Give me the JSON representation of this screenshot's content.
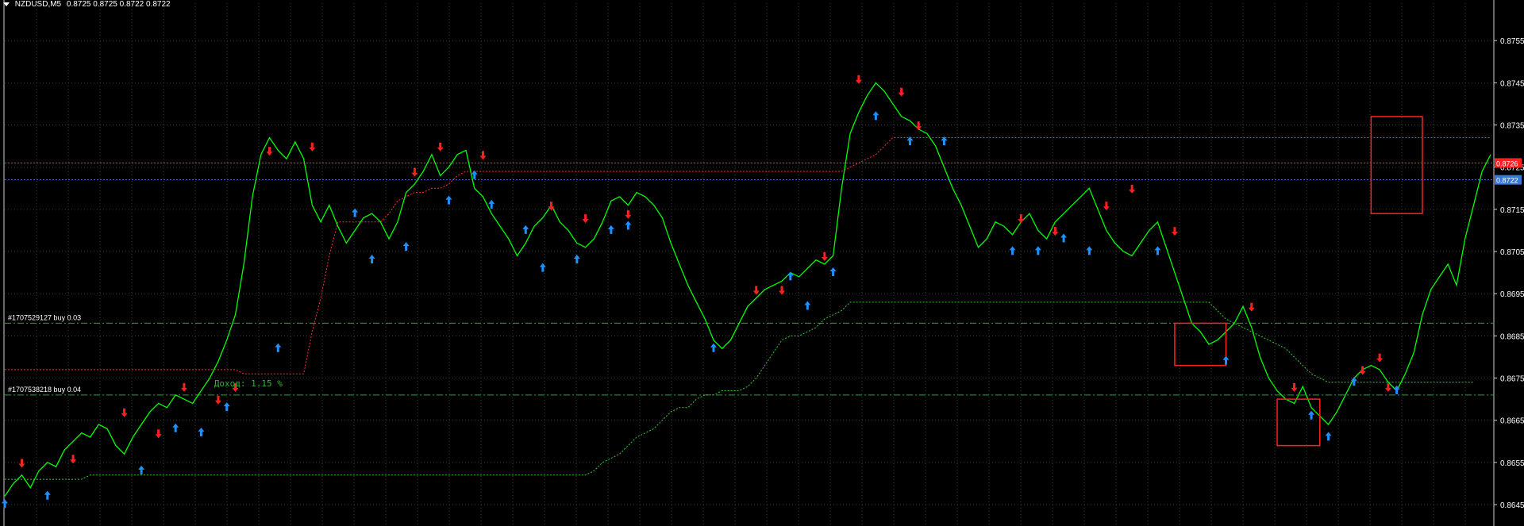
{
  "header": {
    "symbol": "NZDUSD,M5",
    "ohlc": "0.8725 0.8725 0.8722 0.8722"
  },
  "colors": {
    "background": "#000000",
    "price_line": "#00ff00",
    "grid": "#2f3f2f",
    "buy_arrow": "#1e90ff",
    "sell_arrow": "#ff2020",
    "stop_line": "#ff3030",
    "trail_line": "#33cc33",
    "bid_line": "#4169e1",
    "box": "#ff2020",
    "order_line": "#22aa22",
    "axis_text": "#ffffff"
  },
  "chart_data": {
    "type": "line",
    "title": "NZDUSD,M5",
    "ylim": [
      0.8642,
      0.8762
    ],
    "y_ticks": [
      "0.8755",
      "0.8745",
      "0.8735",
      "0.8725",
      "0.8715",
      "0.8705",
      "0.8695",
      "0.8685",
      "0.8675",
      "0.8665",
      "0.8655",
      "0.8645"
    ],
    "price_labels": [
      {
        "text": "0.8726",
        "value": 0.8726,
        "color": "#ff2020"
      },
      {
        "text": "0.8722",
        "value": 0.8722,
        "color": "#3a78d6"
      }
    ],
    "series": [
      {
        "values": [
          0.8647,
          0.865,
          0.8652,
          0.8649,
          0.8653,
          0.8655,
          0.8654,
          0.8658,
          0.866,
          0.8662,
          0.8661,
          0.8664,
          0.8663,
          0.8659,
          0.8657,
          0.8661,
          0.8664,
          0.8667,
          0.8669,
          0.8668,
          0.8671,
          0.867,
          0.8669,
          0.8672,
          0.8675,
          0.8679,
          0.8684,
          0.869,
          0.8702,
          0.8718,
          0.8728,
          0.8732,
          0.8729,
          0.8727,
          0.8731,
          0.8727,
          0.8716,
          0.8712,
          0.8716,
          0.8711,
          0.8707,
          0.871,
          0.8713,
          0.8714,
          0.8712,
          0.8708,
          0.8712,
          0.8719,
          0.8721,
          0.8724,
          0.8728,
          0.8723,
          0.8725,
          0.8728,
          0.8729,
          0.872,
          0.8718,
          0.8714,
          0.8711,
          0.8708,
          0.8704,
          0.8707,
          0.8711,
          0.8713,
          0.8716,
          0.8712,
          0.871,
          0.8707,
          0.8706,
          0.8708,
          0.8712,
          0.8717,
          0.8718,
          0.8716,
          0.8719,
          0.8718,
          0.8716,
          0.8713,
          0.8707,
          0.8702,
          0.8697,
          0.8693,
          0.8689,
          0.8684,
          0.8682,
          0.8684,
          0.8688,
          0.8692,
          0.8694,
          0.8696,
          0.8697,
          0.8698,
          0.87,
          0.8699,
          0.8701,
          0.8703,
          0.8702,
          0.8704,
          0.872,
          0.8733,
          0.8738,
          0.8742,
          0.8745,
          0.8743,
          0.874,
          0.8737,
          0.8736,
          0.8734,
          0.8733,
          0.873,
          0.8725,
          0.872,
          0.8716,
          0.8711,
          0.8706,
          0.8708,
          0.8712,
          0.8711,
          0.8709,
          0.8712,
          0.8714,
          0.871,
          0.8708,
          0.8712,
          0.8714,
          0.8716,
          0.8718,
          0.872,
          0.8715,
          0.871,
          0.8707,
          0.8705,
          0.8704,
          0.8707,
          0.871,
          0.8712,
          0.8706,
          0.87,
          0.8694,
          0.8688,
          0.8686,
          0.8683,
          0.8684,
          0.8686,
          0.8688,
          0.8692,
          0.8687,
          0.868,
          0.8675,
          0.8672,
          0.867,
          0.8669,
          0.8673,
          0.8668,
          0.8666,
          0.8664,
          0.8667,
          0.8671,
          0.8675,
          0.8677,
          0.8678,
          0.8677,
          0.8674,
          0.8672,
          0.8676,
          0.8681,
          0.869,
          0.8696,
          0.8699,
          0.8702,
          0.8697,
          0.8708,
          0.8716,
          0.8724,
          0.8728
        ]
      }
    ],
    "stop_line_values": [
      0.8677,
      0.8677,
      0.8677,
      0.8677,
      0.8677,
      0.8677,
      0.8677,
      0.8677,
      0.8677,
      0.8677,
      0.8677,
      0.8677,
      0.8677,
      0.8677,
      0.8677,
      0.8677,
      0.8677,
      0.8677,
      0.8677,
      0.8677,
      0.8677,
      0.8677,
      0.8677,
      0.8677,
      0.8677,
      0.8677,
      0.8677,
      0.8677,
      0.8676,
      0.8676,
      0.8676,
      0.8676,
      0.8676,
      0.8676,
      0.8676,
      0.8676,
      0.8686,
      0.8694,
      0.8704,
      0.8712,
      0.8712,
      0.8712,
      0.8712,
      0.8712,
      0.8712,
      0.8714,
      0.8717,
      0.8718,
      0.8719,
      0.8719,
      0.872,
      0.872,
      0.8721,
      0.8723,
      0.8724,
      0.8724,
      0.8724,
      0.8724,
      0.8724,
      0.8724,
      0.8724,
      0.8724,
      0.8724,
      0.8724,
      0.8724,
      0.8724,
      0.8724,
      0.8724,
      0.8724,
      0.8724,
      0.8724,
      0.8724,
      0.8724,
      0.8724,
      0.8724,
      0.8724,
      0.8724,
      0.8724,
      0.8724,
      0.8724,
      0.8724,
      0.8724,
      0.8724,
      0.8724,
      0.8724,
      0.8724,
      0.8724,
      0.8724,
      0.8724,
      0.8724,
      0.8724,
      0.8724,
      0.8724,
      0.8724,
      0.8724,
      0.8724,
      0.8724,
      0.8724,
      0.8724,
      0.8725,
      0.8726,
      0.8727,
      0.8728,
      0.873,
      0.8732,
      0.8732,
      0.8732,
      0.8732,
      0.8732,
      0.8732,
      0.8732,
      0.8732,
      0.8732,
      0.8732,
      0.8732,
      0.8732,
      0.8732,
      0.8732,
      0.8732,
      0.8732,
      0.8732,
      0.8732,
      0.8732,
      0.8732,
      0.8732,
      0.8732,
      0.8732,
      0.8732,
      0.8732,
      0.8732,
      0.8732,
      0.8732,
      0.8732,
      0.8732,
      0.8732,
      0.8732,
      0.8732,
      0.8732,
      0.8732,
      0.8732,
      0.8732,
      0.8732,
      0.8732,
      0.8732,
      0.8732,
      0.8732,
      0.8732,
      0.8732,
      0.8732,
      0.8732,
      0.8732,
      0.8732,
      0.8732,
      0.8732,
      0.8732,
      0.8732,
      0.8732,
      0.8732,
      0.8732,
      0.8732,
      0.8732,
      0.8732,
      0.8732,
      0.8732,
      0.8732,
      0.8732,
      0.8732,
      0.8732,
      0.8732,
      0.8732,
      0.8732,
      0.8732,
      0.8732,
      0.8732,
      0.8732
    ],
    "trail_line_values": [
      0.8651,
      0.8651,
      0.8651,
      0.8651,
      0.8651,
      0.8651,
      0.8651,
      0.8651,
      0.8651,
      0.8651,
      0.8652,
      0.8652,
      0.8652,
      0.8652,
      0.8652,
      0.8652,
      0.8652,
      0.8652,
      0.8652,
      0.8652,
      0.8652,
      0.8652,
      0.8652,
      0.8652,
      0.8652,
      0.8652,
      0.8652,
      0.8652,
      0.8652,
      0.8652,
      0.8652,
      0.8652,
      0.8652,
      0.8652,
      0.8652,
      0.8652,
      0.8652,
      0.8652,
      0.8652,
      0.8652,
      0.8652,
      0.8652,
      0.8652,
      0.8652,
      0.8652,
      0.8652,
      0.8652,
      0.8652,
      0.8652,
      0.8652,
      0.8652,
      0.8652,
      0.8652,
      0.8652,
      0.8652,
      0.8652,
      0.8652,
      0.8652,
      0.8652,
      0.8652,
      0.8652,
      0.8652,
      0.8652,
      0.8652,
      0.8652,
      0.8652,
      0.8652,
      0.8652,
      0.8652,
      0.8653,
      0.8655,
      0.8656,
      0.8657,
      0.8659,
      0.8661,
      0.8662,
      0.8663,
      0.8665,
      0.8667,
      0.8668,
      0.8668,
      0.867,
      0.8671,
      0.8671,
      0.8672,
      0.8672,
      0.8672,
      0.8673,
      0.8675,
      0.8678,
      0.8681,
      0.8684,
      0.8685,
      0.8685,
      0.8686,
      0.8687,
      0.8689,
      0.869,
      0.8691,
      0.8693,
      0.8693,
      0.8693,
      0.8693,
      0.8693,
      0.8693,
      0.8693,
      0.8693,
      0.8693,
      0.8693,
      0.8693,
      0.8693,
      0.8693,
      0.8693,
      0.8693,
      0.8693,
      0.8693,
      0.8693,
      0.8693,
      0.8693,
      0.8693,
      0.8693,
      0.8693,
      0.8693,
      0.8693,
      0.8693,
      0.8693,
      0.8693,
      0.8693,
      0.8693,
      0.8693,
      0.8693,
      0.8693,
      0.8693,
      0.8693,
      0.8693,
      0.8693,
      0.8693,
      0.8693,
      0.8693,
      0.8693,
      0.8693,
      0.8693,
      0.8691,
      0.8689,
      0.8688,
      0.8687,
      0.8686,
      0.8685,
      0.8684,
      0.8683,
      0.8682,
      0.868,
      0.8678,
      0.8676,
      0.8675,
      0.8674,
      0.8674,
      0.8674,
      0.8674,
      0.8674,
      0.8674,
      0.8674,
      0.8674,
      0.8674,
      0.8674,
      0.8674,
      0.8674,
      0.8674,
      0.8674,
      0.8674,
      0.8674,
      0.8674,
      0.8674
    ],
    "horizontal_lines": [
      {
        "value": 0.8726,
        "color": "#ff3030",
        "style": "dotted"
      },
      {
        "value": 0.8722,
        "color": "#4169e1",
        "style": "dotted"
      },
      {
        "value": 0.8688,
        "color": "#22aa22",
        "style": "dashdot",
        "label": "#1707529127 buy 0.03"
      },
      {
        "value": 0.8671,
        "color": "#22aa22",
        "style": "dashdot",
        "label": "#1707538218 buy 0.04"
      }
    ],
    "annotations": [
      {
        "text": "Доход: 1.15 %",
        "index": 26,
        "value": 0.8674,
        "color": "#2fb82f"
      }
    ],
    "buy_arrows": [
      [
        0,
        0.8647
      ],
      [
        5,
        0.8649
      ],
      [
        16,
        0.8655
      ],
      [
        20,
        0.8665
      ],
      [
        23,
        0.8664
      ],
      [
        26,
        0.867
      ],
      [
        32,
        0.8684
      ],
      [
        41,
        0.8716
      ],
      [
        43,
        0.8705
      ],
      [
        47,
        0.8708
      ],
      [
        52,
        0.8719
      ],
      [
        55,
        0.8725
      ],
      [
        57,
        0.8718
      ],
      [
        61,
        0.8712
      ],
      [
        63,
        0.8703
      ],
      [
        67,
        0.8705
      ],
      [
        71,
        0.8712
      ],
      [
        73,
        0.8713
      ],
      [
        83,
        0.8684
      ],
      [
        92,
        0.8701
      ],
      [
        94,
        0.8694
      ],
      [
        97,
        0.8702
      ],
      [
        102,
        0.8739
      ],
      [
        106,
        0.8733
      ],
      [
        110,
        0.8733
      ],
      [
        118,
        0.8707
      ],
      [
        121,
        0.8707
      ],
      [
        124,
        0.871
      ],
      [
        127,
        0.8707
      ],
      [
        135,
        0.8707
      ],
      [
        143,
        0.8681
      ],
      [
        153,
        0.8668
      ],
      [
        155,
        0.8663
      ],
      [
        158,
        0.8676
      ],
      [
        163,
        0.8674
      ]
    ],
    "sell_arrows": [
      [
        2,
        0.8653
      ],
      [
        8,
        0.8654
      ],
      [
        14,
        0.8665
      ],
      [
        18,
        0.866
      ],
      [
        21,
        0.8671
      ],
      [
        25,
        0.8668
      ],
      [
        27,
        0.8671
      ],
      [
        31,
        0.8727
      ],
      [
        36,
        0.8728
      ],
      [
        48,
        0.8722
      ],
      [
        51,
        0.8728
      ],
      [
        56,
        0.8726
      ],
      [
        64,
        0.8714
      ],
      [
        68,
        0.8711
      ],
      [
        73,
        0.8712
      ],
      [
        88,
        0.8694
      ],
      [
        91,
        0.8694
      ],
      [
        96,
        0.8702
      ],
      [
        100,
        0.8744
      ],
      [
        105,
        0.8741
      ],
      [
        107,
        0.8733
      ],
      [
        119,
        0.8711
      ],
      [
        123,
        0.8708
      ],
      [
        129,
        0.8714
      ],
      [
        132,
        0.8718
      ],
      [
        137,
        0.8708
      ],
      [
        146,
        0.869
      ],
      [
        151,
        0.8671
      ],
      [
        159,
        0.8675
      ],
      [
        161,
        0.8678
      ],
      [
        162,
        0.8671
      ]
    ],
    "boxes": [
      {
        "i0": 160,
        "i1": 166,
        "y0": 0.8714,
        "y1": 0.8737
      },
      {
        "i0": 137,
        "i1": 143,
        "y0": 0.8678,
        "y1": 0.8688
      },
      {
        "i0": 149,
        "i1": 154,
        "y0": 0.8659,
        "y1": 0.867
      }
    ],
    "grid": true
  }
}
